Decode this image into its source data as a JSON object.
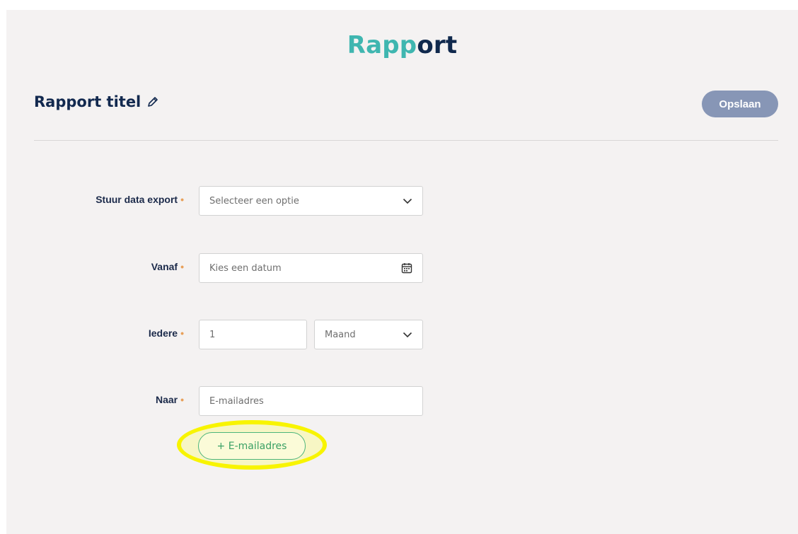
{
  "page": {
    "logo_part1": "Ra",
    "logo_part2": "pp",
    "logo_part3": "ort",
    "title": "Rapport titel",
    "save_label": "Opslaan"
  },
  "form": {
    "send_export": {
      "label": "Stuur data export",
      "required": "•",
      "placeholder": "Selecteer een optie"
    },
    "from": {
      "label": "Vanaf",
      "required": "•",
      "placeholder": "Kies een datum"
    },
    "every": {
      "label": "Iedere",
      "required": "•",
      "number_value": "1",
      "unit_value": "Maand"
    },
    "to": {
      "label": "Naar",
      "required": "•",
      "placeholder": "E-mailadres"
    },
    "add_email_label": "+ E-mailadres"
  },
  "colors": {
    "logo_teal": "#3fb6b0",
    "logo_navy": "#10294d",
    "save_button": "#8796b6",
    "add_button_green": "#3aa165",
    "highlight": "#f8f400"
  }
}
